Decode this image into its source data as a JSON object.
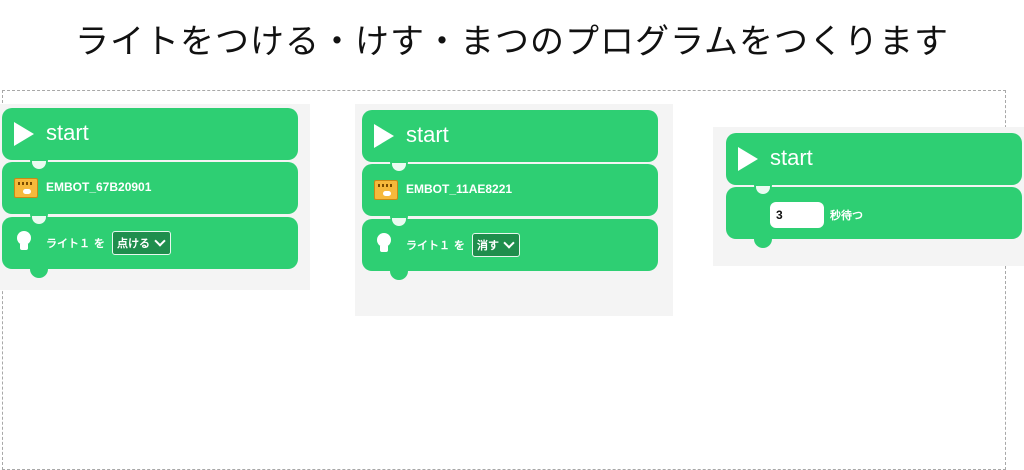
{
  "page": {
    "title": "ライトをつける・けす・まつのプログラムをつくります"
  },
  "colors": {
    "block_green": "#2ecf73",
    "dropdown_green": "#1f8e4d",
    "workspace_bg": "#f4f4f4"
  },
  "programs": [
    {
      "start_label": "start",
      "device_label": "EMBOT_67B20901",
      "light_label": "ライト１ を",
      "light_action": "点ける"
    },
    {
      "start_label": "start",
      "device_label": "EMBOT_11AE8221",
      "light_label": "ライト１ を",
      "light_action": "消す"
    },
    {
      "start_label": "start",
      "wait_value": "3",
      "wait_label": "秒待つ"
    }
  ],
  "icons": {
    "start": "play-icon",
    "device": "robot-icon",
    "light": "light-bulb-icon",
    "dropdown": "chevron-down-icon"
  }
}
